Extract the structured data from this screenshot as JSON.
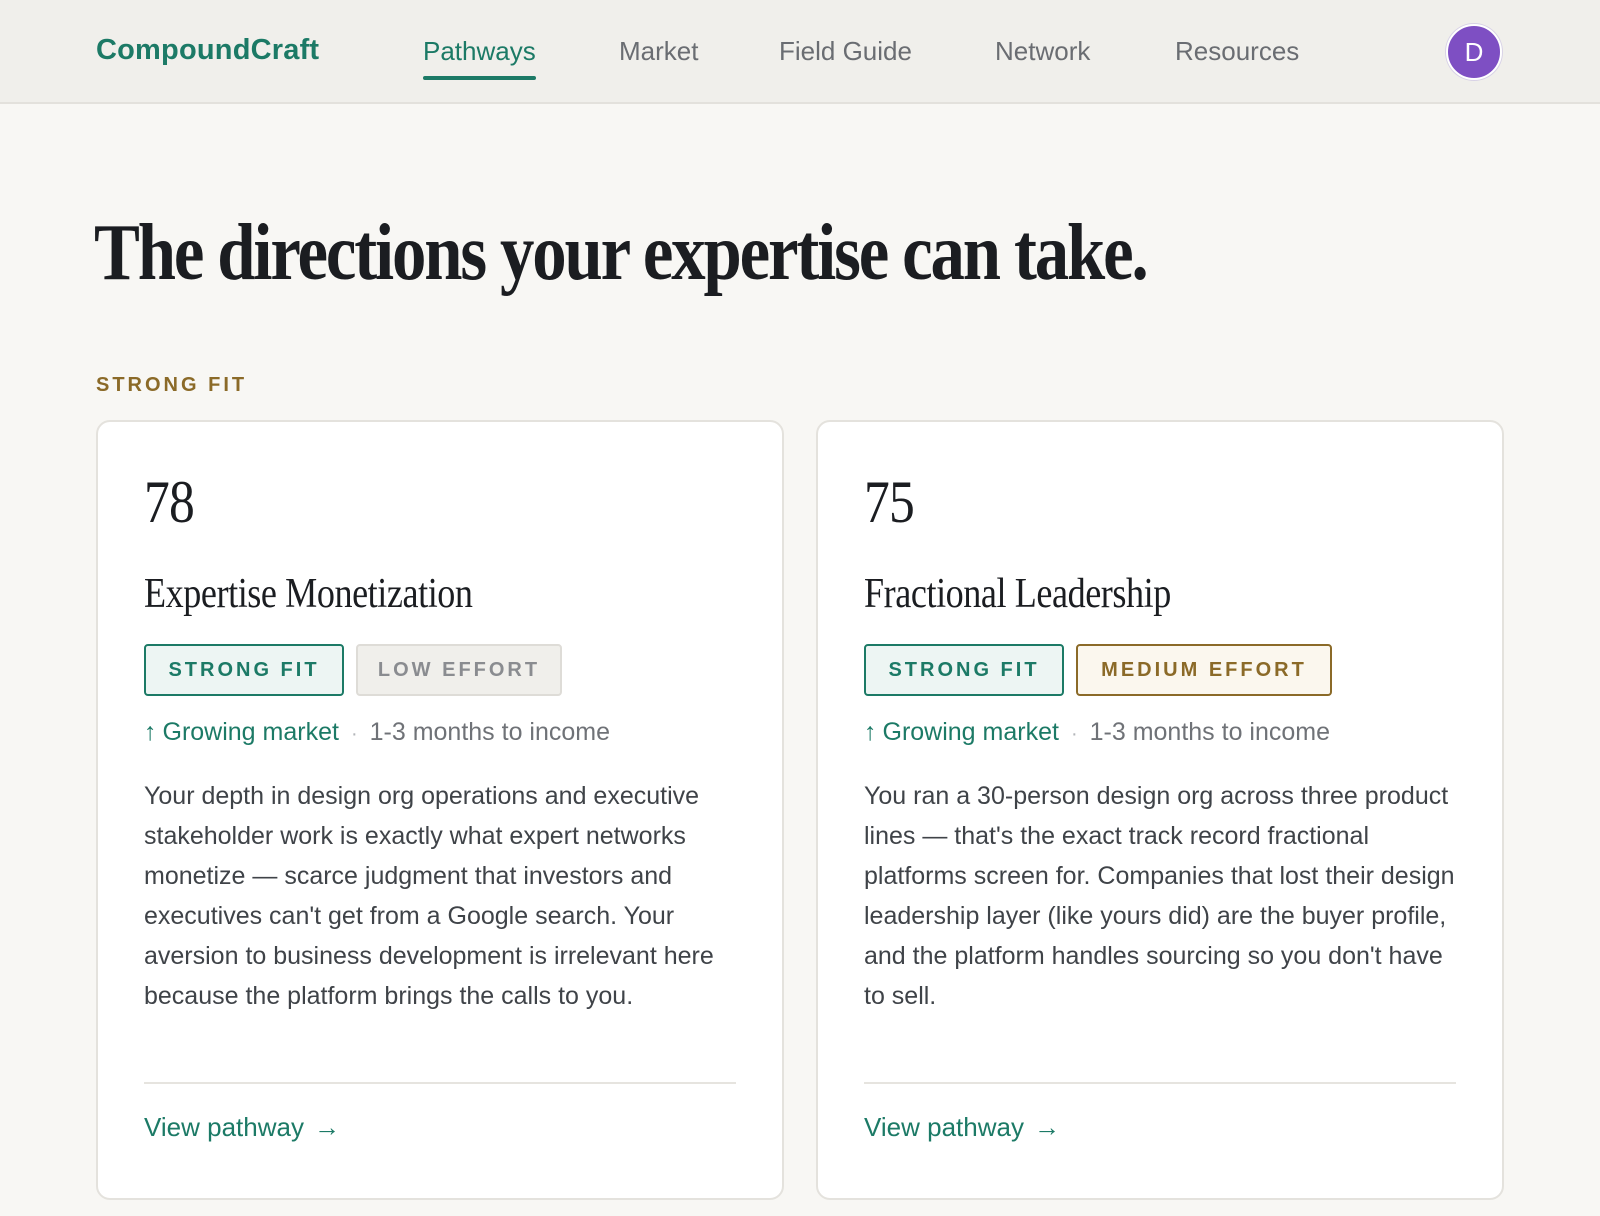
{
  "header": {
    "logo": "CompoundCraft",
    "nav": [
      {
        "label": "Pathways",
        "active": true
      },
      {
        "label": "Market",
        "active": false
      },
      {
        "label": "Field Guide",
        "active": false
      },
      {
        "label": "Network",
        "active": false
      },
      {
        "label": "Resources",
        "active": false
      }
    ],
    "avatar_initial": "D"
  },
  "page": {
    "headline": "The directions your expertise can take.",
    "section_label": "STRONG FIT"
  },
  "cards": [
    {
      "score": "78",
      "title": "Expertise Monetization",
      "badges": [
        "STRONG FIT",
        "LOW EFFORT"
      ],
      "trend_icon": "arrow-up-icon",
      "trend_arrow": "↑",
      "trend": "Growing market",
      "separator": "·",
      "time_to_income": "1-3 months to income",
      "description": "Your depth in design org operations and executive stakeholder work is exactly what expert networks monetize — scarce judgment that investors and executives can't get from a Google search. Your aversion to business development is irrelevant here because the platform brings the calls to you.",
      "link_label": "View pathway",
      "link_arrow": "→"
    },
    {
      "score": "75",
      "title": "Fractional Leadership",
      "badges": [
        "STRONG FIT",
        "MEDIUM EFFORT"
      ],
      "trend_icon": "arrow-up-icon",
      "trend_arrow": "↑",
      "trend": "Growing market",
      "separator": "·",
      "time_to_income": "1-3 months to income",
      "description": "You ran a 30-person design org across three product lines — that's the exact track record fractional platforms screen for. Companies that lost their design leadership layer (like yours did) are the buyer profile, and the platform handles sourcing so you don't have to sell.",
      "link_label": "View pathway",
      "link_arrow": "→"
    }
  ],
  "colors": {
    "brand": "#1c7a66",
    "accent_gold": "#8b6a28",
    "avatar": "#7e4fc3",
    "background": "#f8f7f4"
  }
}
